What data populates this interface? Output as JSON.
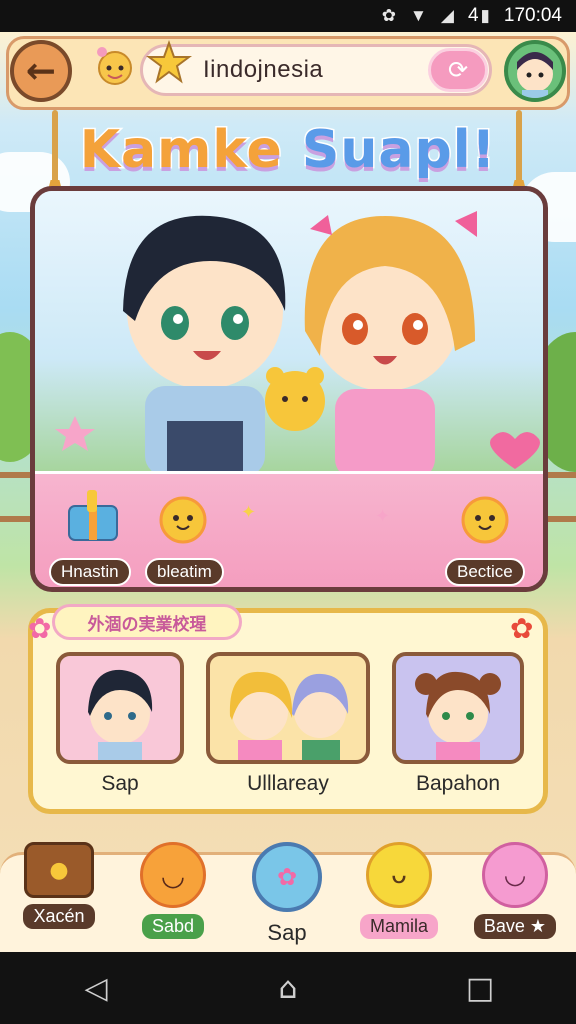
{
  "status_bar": {
    "time": "170:04",
    "battery": "4"
  },
  "header": {
    "search_value": "Iindojnesia"
  },
  "banner": {
    "title_part1": "Kamke",
    "title_part2": "Suapl!"
  },
  "card": {
    "chips": [
      "Hnastin",
      "bleatim",
      "Bectice"
    ]
  },
  "gallery": {
    "heading": "外涸の実業校瑆",
    "items": [
      {
        "label": "Sap"
      },
      {
        "label": "Ulllareay"
      },
      {
        "label": "Bapahon"
      }
    ]
  },
  "dock": {
    "items": [
      {
        "label": "Xacén"
      },
      {
        "label": "Sabd"
      },
      {
        "label": "Sap"
      },
      {
        "label": "Mamila"
      },
      {
        "label": "Bave ★"
      }
    ]
  },
  "colors": {
    "accent_pink": "#f49bbd",
    "frame_brown": "#6a3c3c",
    "gold": "#e7b84a"
  }
}
